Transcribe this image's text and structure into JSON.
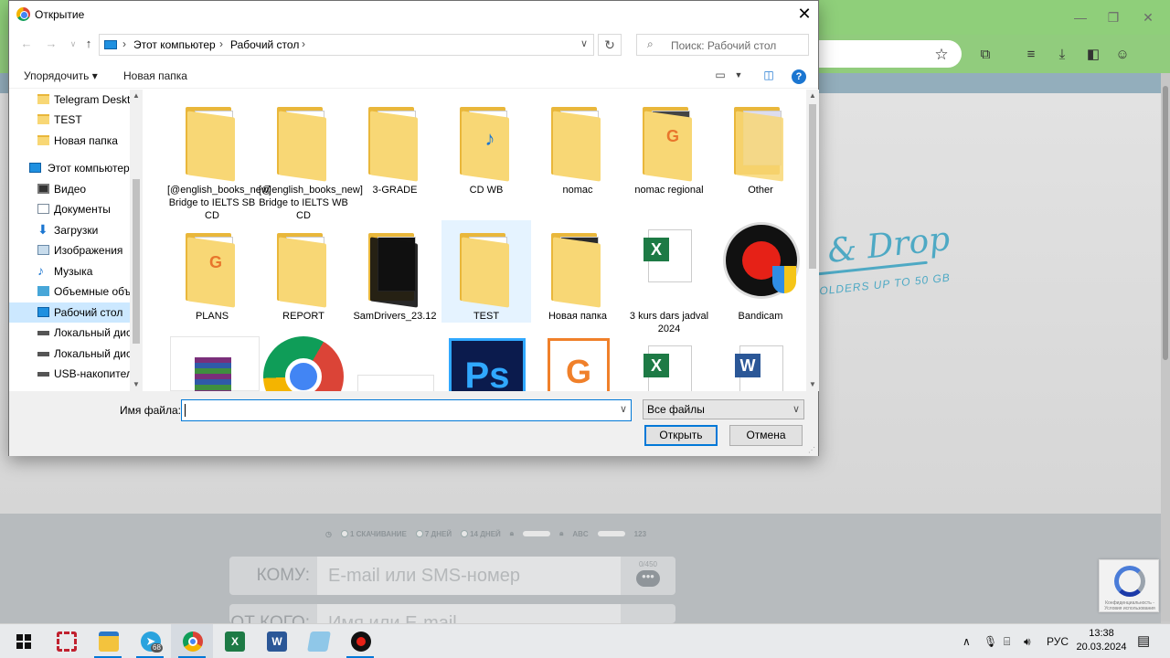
{
  "browser": {
    "page": {
      "drag_title": "& Drop",
      "drag_subtitle": "OLDERS UP TO 50 GB",
      "options": {
        "opt1": "1 СКАЧИВАНИЕ",
        "opt2": "7 ДНЕЙ",
        "opt3": "14 ДНЕЙ",
        "abc": "ABC",
        "num": "123"
      },
      "to_label": "КОМУ:",
      "to_placeholder": "E-mail или SMS-номер",
      "to_counter": "0/450",
      "from_label": "ОТ КОГО:",
      "from_placeholder": "Имя или E-mail",
      "recaptcha_text": "Конфиденциальность - Условия использования"
    }
  },
  "dialog": {
    "title": "Открытие",
    "address": {
      "crumb1": "Этот компьютер",
      "crumb2": "Рабочий стол"
    },
    "search_placeholder": "Поиск: Рабочий стол",
    "toolbar": {
      "organize": "Упорядочить ▾",
      "new_folder": "Новая папка"
    },
    "sidebar": [
      {
        "label": "Telegram Deskto"
      },
      {
        "label": "TEST"
      },
      {
        "label": "Новая папка"
      },
      {
        "label": "Этот компьютер"
      },
      {
        "label": "Видео"
      },
      {
        "label": "Документы"
      },
      {
        "label": "Загрузки"
      },
      {
        "label": "Изображения"
      },
      {
        "label": "Музыка"
      },
      {
        "label": "Объемные объ"
      },
      {
        "label": "Рабочий стол"
      },
      {
        "label": "Локальный дис"
      },
      {
        "label": "Локальный дис"
      },
      {
        "label": "USB-накопител"
      }
    ],
    "files": [
      {
        "label": "[@english_books_new] Bridge to IELTS SB CD"
      },
      {
        "label": "[@english_books_new] Bridge to IELTS WB CD"
      },
      {
        "label": "3-GRADE"
      },
      {
        "label": "CD WB"
      },
      {
        "label": "nomac"
      },
      {
        "label": "nomac regional"
      },
      {
        "label": "Other"
      },
      {
        "label": "PLANS"
      },
      {
        "label": "REPORT"
      },
      {
        "label": "SamDrivers_23.12"
      },
      {
        "label": "TEST"
      },
      {
        "label": "Новая папка"
      },
      {
        "label": "3 kurs dars jadval 2024"
      },
      {
        "label": "Bandicam"
      }
    ],
    "file_name_label": "Имя файла:",
    "file_name_value": "",
    "file_type": "Все файлы",
    "open_button": "Открыть",
    "cancel_button": "Отмена"
  },
  "taskbar": {
    "lang": "РУС",
    "time": "13:38",
    "date": "20.03.2024",
    "telegram_badge": "68"
  },
  "colors": {
    "accent": "#0078d7",
    "chrome_green": "#8fcf7a",
    "folder": "#f8d775",
    "selection": "#cce8ff"
  }
}
